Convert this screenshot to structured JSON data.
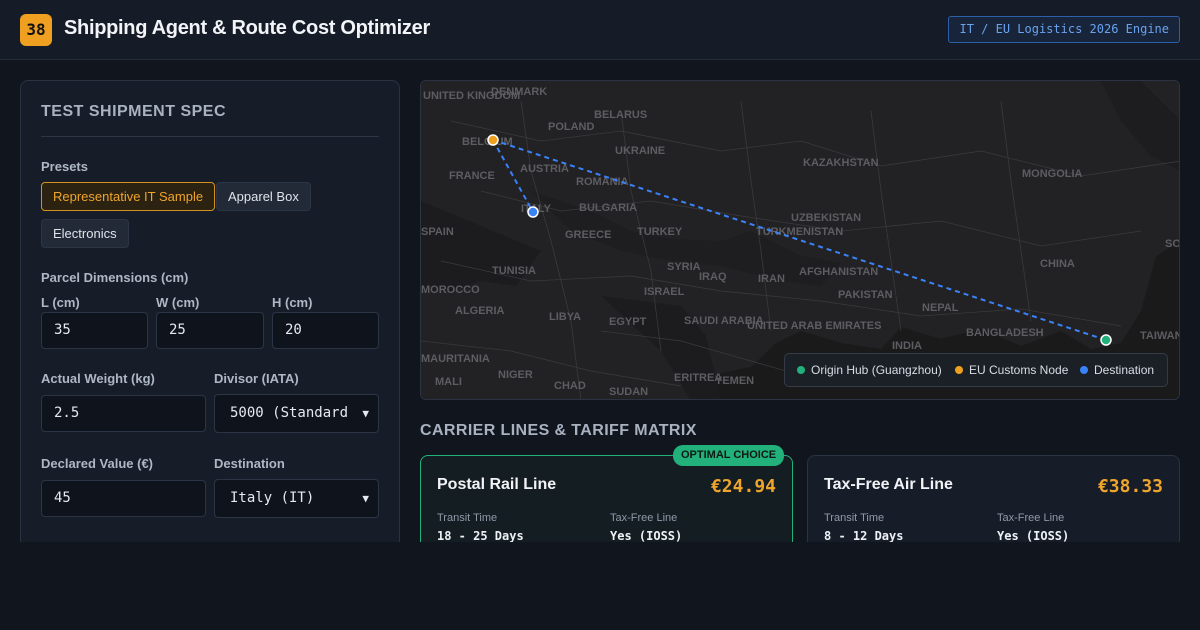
{
  "header": {
    "logo_text": "38",
    "title": "Shipping Agent & Route Cost Optimizer",
    "engine_badge": "IT / EU Logistics 2026 Engine"
  },
  "spec": {
    "title": "TEST SHIPMENT SPEC",
    "presets_label": "Presets",
    "presets": [
      {
        "label": "Representative IT Sample",
        "active": true
      },
      {
        "label": "Apparel Box",
        "active": false
      },
      {
        "label": "Electronics",
        "active": false
      }
    ],
    "dimensions_label": "Parcel Dimensions (cm)",
    "length_label": "L (cm)",
    "length_value": "35",
    "width_label": "W (cm)",
    "width_value": "25",
    "height_label": "H (cm)",
    "height_value": "20",
    "weight_label": "Actual Weight (kg)",
    "weight_value": "2.5",
    "divisor_label": "Divisor (IATA)",
    "divisor_value": "5000 (Standard",
    "declared_label": "Declared Value (€)",
    "declared_value": "45",
    "destination_label": "Destination",
    "destination_value": "Italy (IT)"
  },
  "map": {
    "country_labels": [
      "UNITED KINGDOM",
      "DENMARK",
      "BELARUS",
      "POLAND",
      "BELGIUM",
      "UKRAINE",
      "KAZAKHSTAN",
      "FRANCE",
      "AUSTRIA",
      "ROMANIA",
      "MONGOLIA",
      "ITALY",
      "BULGARIA",
      "UZBEKISTAN",
      "SPAIN",
      "GREECE",
      "TURKEY",
      "TURKMENISTAN",
      "CHINA",
      "TUNISIA",
      "SYRIA",
      "IRAQ",
      "IRAN",
      "AFGHANISTAN",
      "MOROCCO",
      "ISRAEL",
      "PAKISTAN",
      "ALGERIA",
      "LIBYA",
      "EGYPT",
      "SAUDI ARABIA",
      "NEPAL",
      "UNITED ARAB EMIRATES",
      "BANGLADESH",
      "INDIA",
      "TAIWAN",
      "MAURITANIA",
      "NIGER",
      "MALI",
      "CHAD",
      "SUDAN",
      "ERITREA",
      "YEMEN",
      "SOUTH KOREA"
    ],
    "legend": {
      "origin": "Origin Hub (Guangzhou)",
      "customs": "EU Customs Node",
      "destination": "Destination"
    },
    "colors": {
      "origin": "#22b07b",
      "customs": "#f0a020",
      "destination": "#3b82f6",
      "route": "#3b82f6"
    }
  },
  "matrix": {
    "title": "CARRIER LINES & TARIFF MATRIX",
    "cards": [
      {
        "name": "Postal Rail Line",
        "price": "€24.94",
        "badge": "OPTIMAL CHOICE",
        "transit_label": "Transit Time",
        "transit_value": "18 - 25 Days",
        "taxfree_label": "Tax-Free Line",
        "taxfree_value": "Yes (IOSS)"
      },
      {
        "name": "Tax-Free Air Line",
        "price": "€38.33",
        "transit_label": "Transit Time",
        "transit_value": "8 - 12 Days",
        "taxfree_label": "Tax-Free Line",
        "taxfree_value": "Yes (IOSS)"
      }
    ]
  }
}
